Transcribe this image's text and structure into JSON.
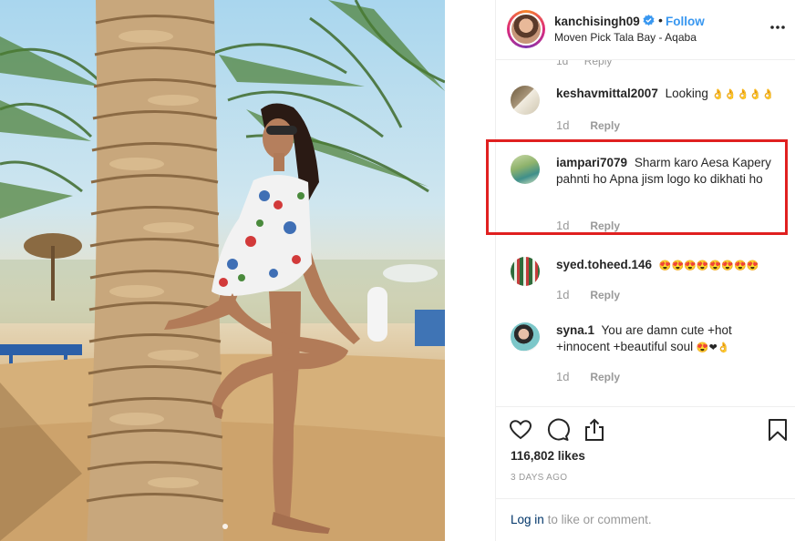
{
  "post": {
    "username": "kanchisingh09",
    "separator": "•",
    "follow_label": "Follow",
    "location": "Moven Pick Tala Bay - Aqaba",
    "more_icon": "more-horizontal-icon",
    "verified_icon": "verified-badge-icon"
  },
  "comments": {
    "cut_off": {
      "age": "1d",
      "reply": "Reply"
    },
    "items": [
      {
        "username": "keshavmittal2007",
        "text": "Looking",
        "emoji": "👌👌👌👌👌",
        "age": "1d",
        "reply": "Reply"
      },
      {
        "username": "iampari7079",
        "text": "Sharm karo Aesa Kapery pahnti ho Apna jism logo ko dikhati ho",
        "emoji": "",
        "age": "1d",
        "reply": "Reply"
      },
      {
        "username": "syed.toheed.146",
        "text": "",
        "emoji": "😍😍😍😍😍😍😍😍",
        "age": "1d",
        "reply": "Reply"
      },
      {
        "username": "syna.1",
        "text": "You are damn cute +hot +innocent +beautiful soul",
        "emoji": "😍❤👌",
        "age": "1d",
        "reply": "Reply"
      }
    ]
  },
  "actions": {
    "like_icon": "heart-icon",
    "comment_icon": "comment-icon",
    "share_icon": "share-icon",
    "save_icon": "bookmark-icon",
    "likes": "116,802 likes",
    "date": "3 DAYS AGO"
  },
  "login": {
    "link": "Log in",
    "rest": "to like or comment."
  },
  "colors": {
    "link_blue": "#3897f0",
    "highlight_red": "#e02020",
    "muted": "#999999"
  }
}
